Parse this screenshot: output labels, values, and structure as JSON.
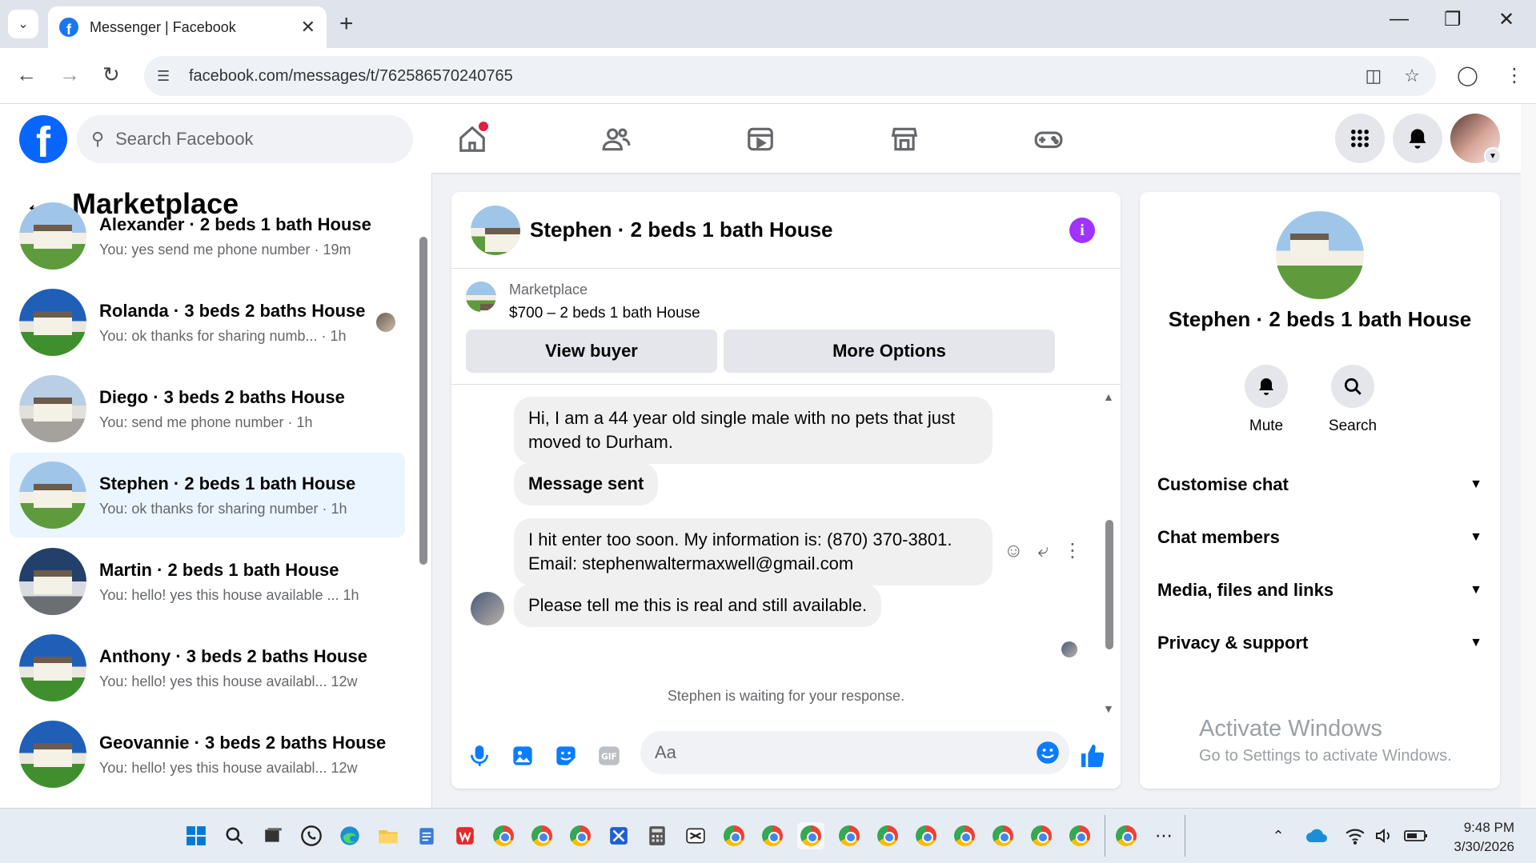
{
  "browser": {
    "tab_title": "Messenger | Facebook",
    "url": "facebook.com/messages/t/762586570240765"
  },
  "header": {
    "search_placeholder": "Search Facebook"
  },
  "sidebar": {
    "title": "Marketplace",
    "conversations": [
      {
        "name": "Alexander · 2 beds 1 bath House",
        "preview": "You: yes send me phone number · 19m"
      },
      {
        "name": "Rolanda · 3 beds 2 baths House",
        "preview": "You: ok thanks for sharing numb... · 1h"
      },
      {
        "name": "Diego · 3 beds 2 baths House",
        "preview": "You: send me phone number · 1h"
      },
      {
        "name": "Stephen · 2 beds 1 bath House",
        "preview": "You: ok thanks for sharing number · 1h"
      },
      {
        "name": "Martin · 2 beds 1 bath House",
        "preview": "You: hello! yes this house available ...   1h"
      },
      {
        "name": "Anthony · 3 beds 2 baths House",
        "preview": "You: hello! yes this house availabl...   12w"
      },
      {
        "name": "Geovannie · 3 beds 2 baths House",
        "preview": "You: hello! yes this house availabl...   12w"
      }
    ]
  },
  "chat": {
    "title": "Stephen · 2 beds 1 bath House",
    "listing_label": "Marketplace",
    "listing_price": "$700 – 2 beds 1 bath House",
    "view_buyer": "View buyer",
    "more_options": "More Options",
    "messages": [
      "Hi, I am a 44 year old single male with no pets that just moved to Durham.",
      "Message sent",
      "I hit enter too soon.  My information is: (870) 370-3801. Email: stephenwaltermaxwell@gmail.com",
      "Please tell me this is real and still available."
    ],
    "waiting": "Stephen is waiting for your response.",
    "input_placeholder": "Aa"
  },
  "details": {
    "name": "Stephen · 2 beds 1 bath House",
    "mute": "Mute",
    "search": "Search",
    "sections": [
      "Customise chat",
      "Chat members",
      "Media, files and links",
      "Privacy & support"
    ]
  },
  "watermark": {
    "line1": "Activate Windows",
    "line2": "Go to Settings to activate Windows."
  },
  "taskbar": {
    "time": "9:48 PM",
    "date": "3/30/2026"
  },
  "colors": {
    "facebook_blue": "#0866ff",
    "messenger_blue": "#0a7cff",
    "info_purple": "#a033ff",
    "active_row": "#ebf5ff"
  }
}
